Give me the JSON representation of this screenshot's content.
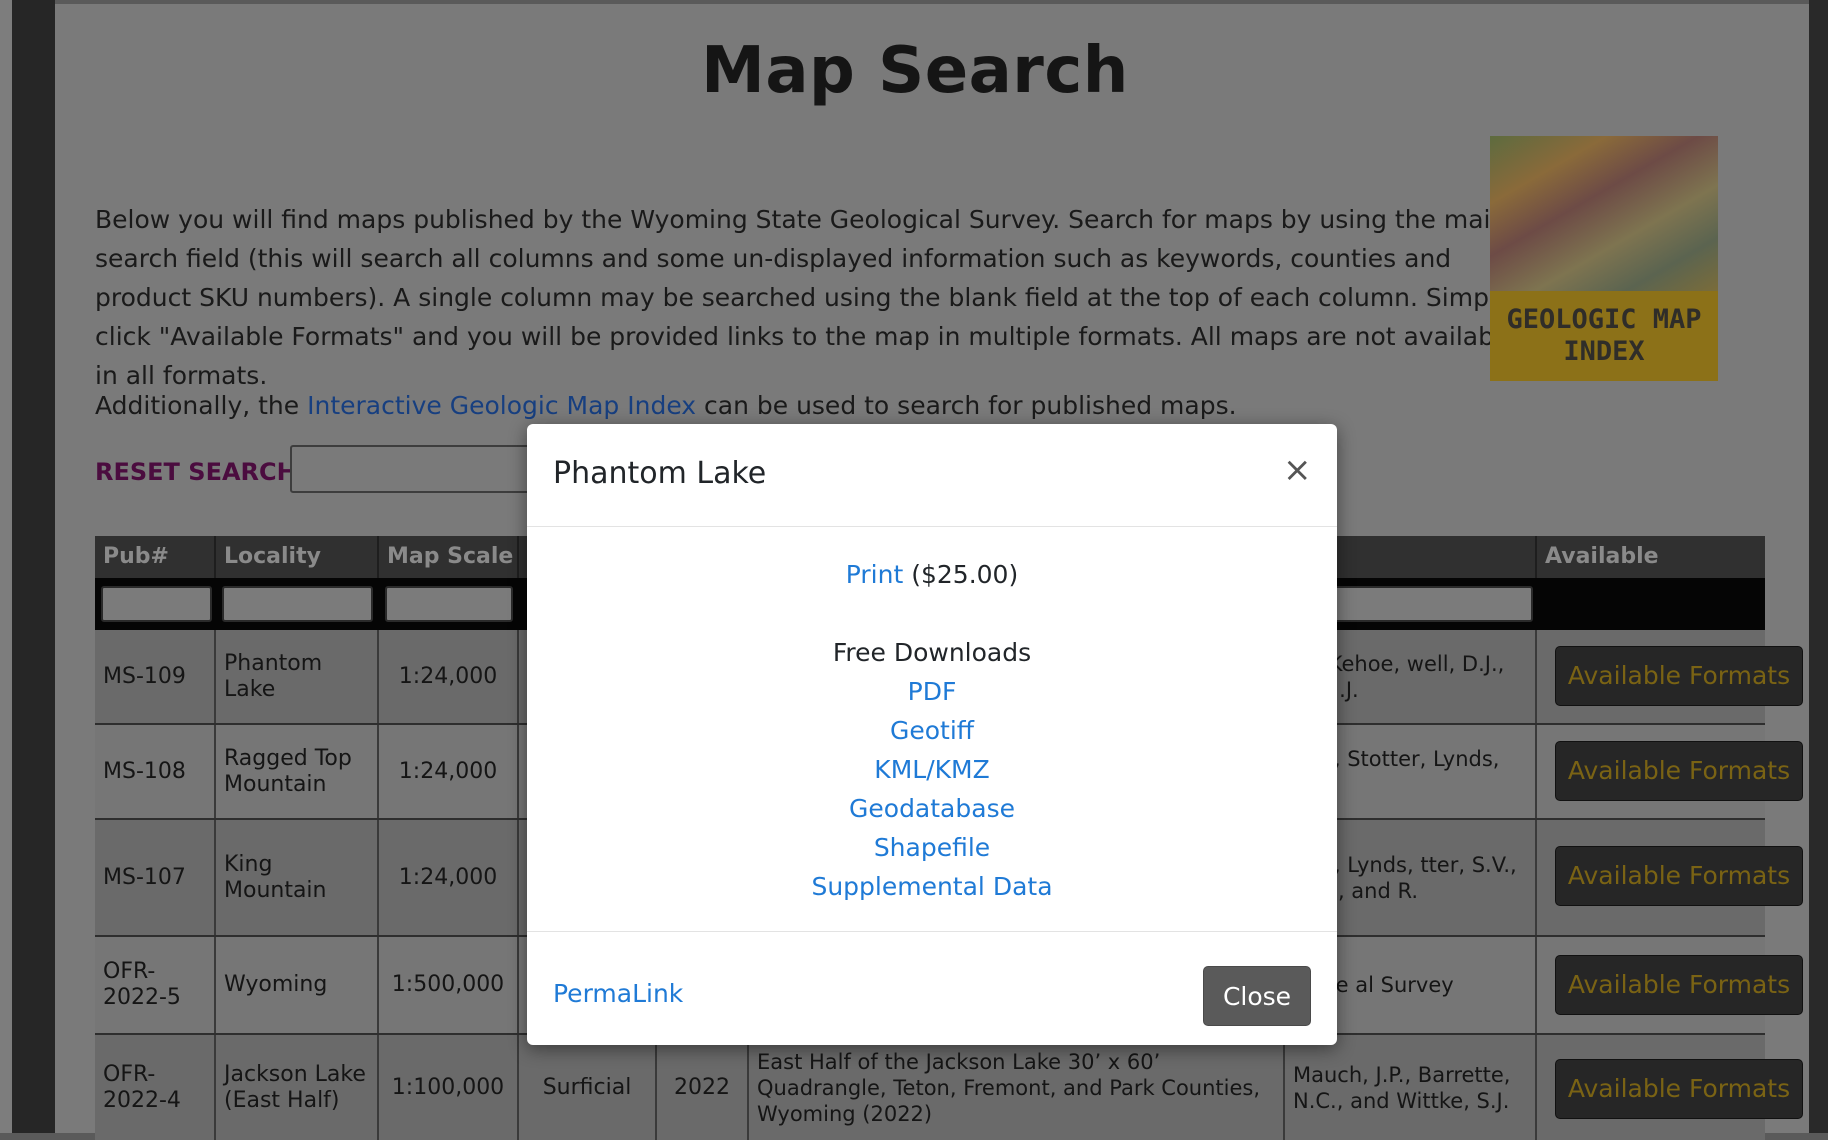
{
  "page": {
    "title": "Map Search",
    "intro": "Below you will find maps published by the Wyoming State Geological Survey. Search for maps by using the main search field (this will search all columns and some un-displayed information such as keywords, counties and product SKU numbers). A single column may be searched using the blank field at the top of each column. Simply click \"Available Formats\" and you will be provided links to the map in multiple formats. All maps are not available in all formats.",
    "additionally_prefix": "Additionally, the ",
    "interactive_link": "Interactive Geologic Map Index",
    "additionally_suffix": " can be used to search for published maps.",
    "index_thumb_line1": "GEOLOGIC MAP",
    "index_thumb_line2": "INDEX",
    "reset_label": "RESET SEARCH"
  },
  "table": {
    "headers": {
      "pub": "Pub#",
      "locality": "Locality",
      "scale": "Map Scale",
      "formats": "Available Formats"
    },
    "rows": [
      {
        "pub": "MS-109",
        "locality": "Phantom Lake",
        "scale": "1:24,000",
        "type": "",
        "year": "",
        "title": "",
        "authors": "N., Kehoe, well, D.J., and .J.",
        "button": "Available Formats"
      },
      {
        "pub": "MS-108",
        "locality": "Ragged Top Mountain",
        "scale": "1:24,000",
        "type": "",
        "year": "",
        "title": "",
        "authors": "P.M., Stotter, Lynds, R.M.",
        "button": "Available Formats"
      },
      {
        "pub": "MS-107",
        "locality": "King Mountain",
        "scale": "1:24,000",
        "type": "",
        "year": "",
        "title": "",
        "authors": "P.M., Lynds, tter, S.V., D.H., and R.",
        "button": "Available Formats"
      },
      {
        "pub": "OFR-2022-5",
        "locality": "Wyoming",
        "scale": "1:500,000",
        "type": "",
        "year": "",
        "title": "",
        "authors": "State al Survey",
        "button": "Available Formats"
      },
      {
        "pub": "OFR-2022-4",
        "locality": "Jackson Lake (East Half)",
        "scale": "1:100,000",
        "type": "Surficial",
        "year": "2022",
        "title": "East Half of the Jackson Lake 30’ x 60’ Quadrangle, Teton, Fremont, and Park Counties, Wyoming (2022)",
        "authors": "Mauch, J.P., Barrette, N.C., and Wittke, S.J.",
        "button": "Available Formats"
      }
    ]
  },
  "modal": {
    "title": "Phantom Lake",
    "close_x": "×",
    "print_link": "Print",
    "print_price": " ($25.00)",
    "free_downloads": "Free Downloads",
    "downloads": [
      "PDF",
      "Geotiff",
      "KML/KMZ",
      "Geodatabase",
      "Shapefile",
      "Supplemental Data"
    ],
    "permalink": "PermaLink",
    "close_button": "Close"
  },
  "colors": {
    "link": "#1f7ad6",
    "button_text": "#7a6314",
    "reset_label": "#4b0c3f"
  }
}
